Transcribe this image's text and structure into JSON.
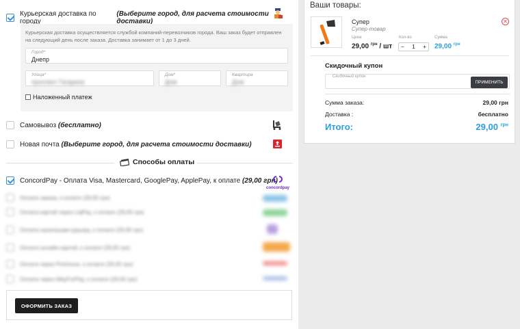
{
  "delivery": {
    "courier": {
      "label": "Курьерская доставка по городу",
      "hint": "(Выберите город, для расчета стоимости доставки)",
      "note": "Курьерская доставка осуществляется службой компаний-перевозчиков города. Ваш заказ будет отправлен на следующий день после заказа. Доставка занимает от 1 до 3 дней.",
      "city_label": "Город*",
      "city_value": "Днепр",
      "street_label": "Улица*",
      "street_value": "проспект Гагарина",
      "house_label": "Дом*",
      "house_value": "Дом",
      "apt_label": "Квартира",
      "apt_value": "Дом",
      "cod_label": "Наложенный платеж"
    },
    "pickup": {
      "label": "Самовывоз",
      "hint": "(бесплатно)"
    },
    "novaposhta": {
      "label": "Новая почта",
      "hint": "(Выберите город, для расчета стоимости доставки)"
    }
  },
  "payment": {
    "title": "Способы оплаты",
    "concord": {
      "label": "ConcordPay - Оплата Visa, Mastercard, GooglePay, ApplePay, к оплате",
      "amount": "(29,00 грн)",
      "logo_text": "concordpay"
    },
    "blurred": [
      {
        "label": "Оплата заказа, к оплате (29,00 грн)"
      },
      {
        "label": "Оплата картой через LiqPay, к оплате (29,00 грн)"
      },
      {
        "label": "Оплата наличными курьеру, к оплате (29,00 грн)"
      },
      {
        "label": "Оплата онлайн картой, к оплате (29,00 грн)"
      },
      {
        "label": "Оплата через Portmone, к оплате (29,00 грн)"
      },
      {
        "label": "Оплата через WayForPay, к оплате (29,00 грн)"
      }
    ],
    "order_button": "ОФОРМИТЬ ЗАКАЗ"
  },
  "cart": {
    "title": "Ваши товары:",
    "product": {
      "name": "Супер",
      "type": "Супер-товар",
      "price_label": "Цена",
      "qty_label": "Кол-во",
      "sum_label": "Сумма",
      "price": "29,00",
      "price_unit": "грн",
      "per_unit": "/ шт",
      "qty": "1",
      "sum": "29,00",
      "sum_unit": "грн"
    },
    "coupon": {
      "title": "Скидочный купон",
      "placeholder": "Скидочный купон",
      "apply": "ПРИМЕНИТЬ"
    },
    "totals": {
      "order_sum_label": "Сумма заказа:",
      "order_sum_value": "29,00 грн",
      "delivery_label": "Доставка :",
      "delivery_value": "бесплатно",
      "total_label": "Итого:",
      "total_value": "29,00",
      "total_unit": "грн"
    }
  },
  "colors": {
    "accent": "#2a9fe0",
    "check": "#3a8fd6",
    "remove": "#e34a4a",
    "dark_button": "#1e1e1e"
  }
}
